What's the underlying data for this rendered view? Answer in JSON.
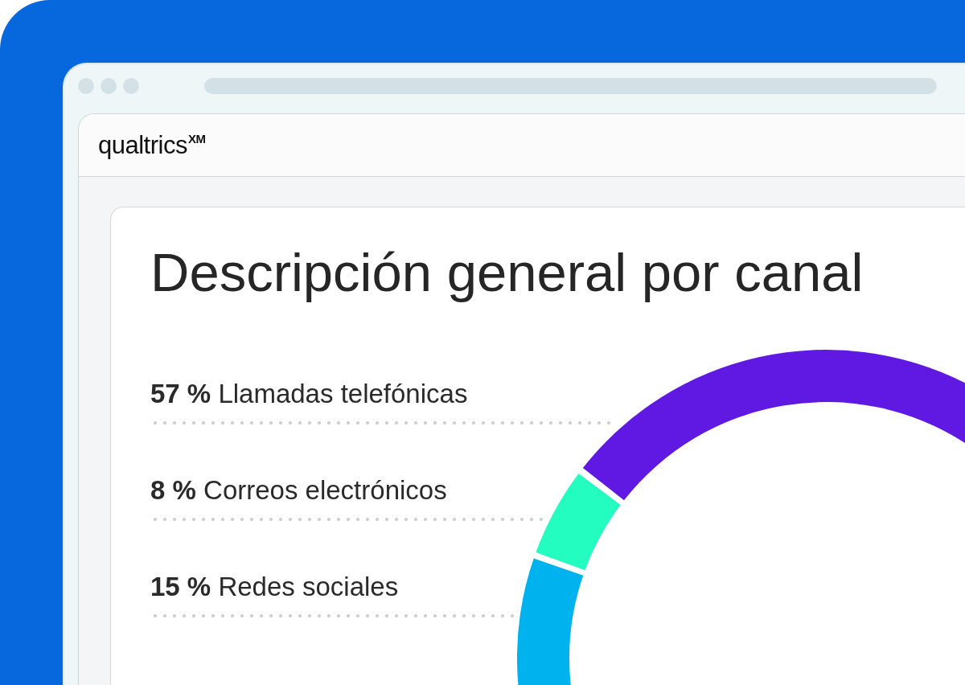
{
  "app": {
    "logo": "qualtrics$^{XM}$"
  },
  "card": {
    "title": "Descripción general por canal",
    "channels": [
      {
        "text": "**57 %** Llamadas telefónicas"
      },
      {
        "text": "**8 %** Correos electrónicos"
      },
      {
        "text": "**15 %** Redes sociales"
      }
    ]
  }
}
